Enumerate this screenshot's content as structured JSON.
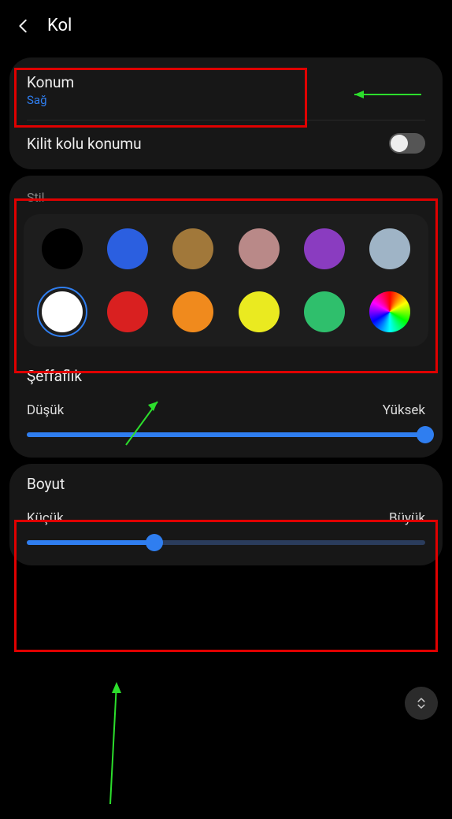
{
  "header": {
    "title": "Kol"
  },
  "position": {
    "title": "Konum",
    "value": "Sağ"
  },
  "lock": {
    "title": "Kilit kolu konumu",
    "on": false
  },
  "style": {
    "label": "Stil",
    "selected_index": 6,
    "colors": [
      "#000000",
      "#2b5fe0",
      "#a1783a",
      "#b98988",
      "#8a3cc0",
      "#9fb4c6",
      "#ffffff",
      "#d92020",
      "#f08a1d",
      "#eaea20",
      "#2fbf6c",
      "rainbow"
    ]
  },
  "opacity": {
    "title": "Şeffaflık",
    "low_label": "Düşük",
    "high_label": "Yüksek",
    "value_pct": 100
  },
  "size": {
    "title": "Boyut",
    "low_label": "Küçük",
    "high_label": "Büyük",
    "value_pct": 32
  }
}
